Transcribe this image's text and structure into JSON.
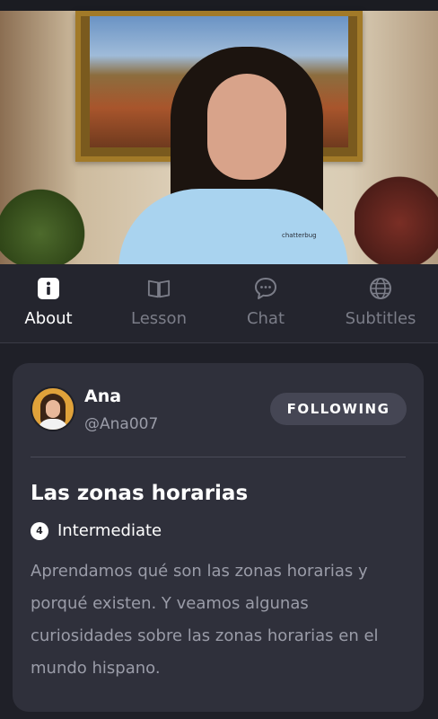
{
  "video": {
    "brand_text": "chatterbug"
  },
  "tabs": [
    {
      "label": "About",
      "icon": "info-icon",
      "active": true
    },
    {
      "label": "Lesson",
      "icon": "book-icon",
      "active": false
    },
    {
      "label": "Chat",
      "icon": "chat-bubble-icon",
      "active": false
    },
    {
      "label": "Subtitles",
      "icon": "globe-icon",
      "active": false
    }
  ],
  "author": {
    "name": "Ana",
    "handle": "@Ana007",
    "follow_label": "FOLLOWING"
  },
  "lesson": {
    "title": "Las zonas horarias",
    "level_number": "4",
    "level_label": "Intermediate",
    "description": "Aprendamos qué son las zonas horarias y porqué existen. Y veamos algunas curiosidades sobre las zonas horarias en el mundo hispano."
  },
  "colors": {
    "background": "#1f2028",
    "card": "#2f303b",
    "tab_bar": "#24252e",
    "active_text": "#ffffff",
    "inactive_text": "#7b7d88",
    "button": "#454654"
  }
}
